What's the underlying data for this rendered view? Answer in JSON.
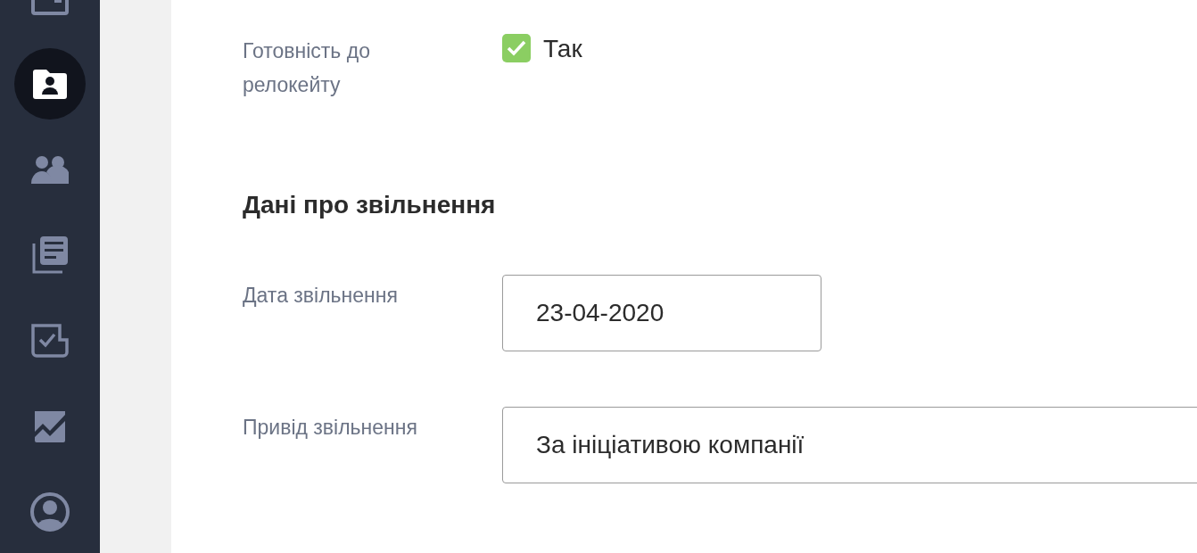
{
  "sidebar": {
    "items": [
      {
        "selected": false
      },
      {
        "selected": true
      },
      {
        "selected": false
      },
      {
        "selected": false
      },
      {
        "selected": false
      },
      {
        "selected": false
      },
      {
        "selected": false
      }
    ]
  },
  "relocation": {
    "label": "Готовність до релокейту",
    "checked": true,
    "value": "Так"
  },
  "dismissal": {
    "title": "Дані про звільнення",
    "fields": [
      {
        "label": "Дата звільнення",
        "value": "23-04-2020",
        "kind": "date"
      },
      {
        "label": "Привід звільнення",
        "value": "За ініціативою компанії",
        "kind": "text"
      }
    ]
  }
}
